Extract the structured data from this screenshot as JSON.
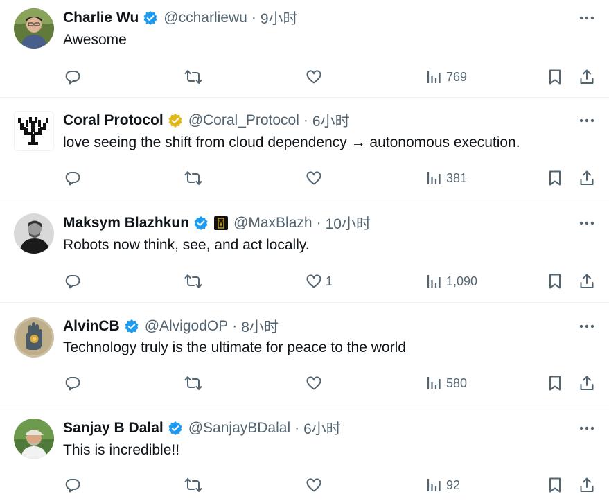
{
  "tweets": [
    {
      "name": "Charlie Wu",
      "badge": "blue",
      "affiliate": false,
      "handle": "@ccharliewu",
      "dot": "·",
      "time": "9小时",
      "text": "Awesome",
      "replies": "",
      "retweets": "",
      "likes": "",
      "views": "769",
      "avatar": "person-green"
    },
    {
      "name": "Coral Protocol",
      "badge": "gold",
      "affiliate": false,
      "handle": "@Coral_Protocol",
      "dot": "·",
      "time": "6小时",
      "text": "love seeing the shift from cloud dependency → autonomous execution.",
      "replies": "",
      "retweets": "",
      "likes": "",
      "views": "381",
      "avatar": "coral-logo"
    },
    {
      "name": "Maksym Blazhkun",
      "badge": "blue",
      "affiliate": true,
      "handle": "@MaxBlazh",
      "dot": "·",
      "time": "10小时",
      "text": "Robots now think, see, and act locally.",
      "replies": "",
      "retweets": "",
      "likes": "1",
      "views": "1,090",
      "avatar": "person-bw"
    },
    {
      "name": "AlvinCB",
      "badge": "blue",
      "affiliate": false,
      "handle": "@AlvigodOP",
      "dot": "·",
      "time": "8小时",
      "text": "Technology truly is the ultimate for peace to the world",
      "replies": "",
      "retweets": "",
      "likes": "",
      "views": "580",
      "avatar": "hand-art"
    },
    {
      "name": "Sanjay B Dalal",
      "badge": "blue",
      "affiliate": false,
      "handle": "@SanjayBDalal",
      "dot": "·",
      "time": "6小时",
      "text": "This is incredible!!",
      "replies": "",
      "retweets": "",
      "likes": "",
      "views": "92",
      "avatar": "person-cap"
    }
  ],
  "colors": {
    "blue_badge": "#1d9bf0",
    "gold_badge": "#e2b719",
    "icon_gray": "#536471",
    "separator": "#eff3f4"
  }
}
